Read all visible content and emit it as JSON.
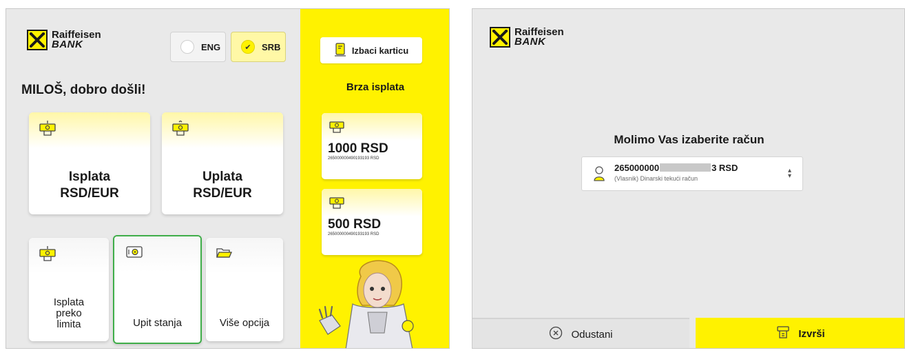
{
  "left_screen": {
    "logo": {
      "line1": "Raiffeisen",
      "line2": "BANK"
    },
    "languages": [
      {
        "label": "ENG",
        "selected": false
      },
      {
        "label": "SRB",
        "selected": true
      }
    ],
    "greeting": "MILOŠ, dobro došli!",
    "main_tiles": [
      {
        "line1": "Isplata",
        "line2": "RSD/EUR",
        "icon": "cash-withdrawal-icon"
      },
      {
        "line1": "Uplata",
        "line2": "RSD/EUR",
        "icon": "cash-deposit-icon"
      }
    ],
    "small_tiles": [
      {
        "line1": "Isplata",
        "line2": "preko",
        "line3": "limita",
        "icon": "cash-withdrawal-icon"
      },
      {
        "line1": "Upit stanja",
        "icon": "safe-icon",
        "highlighted": true
      },
      {
        "line1": "Više opcija",
        "icon": "folder-icon"
      }
    ],
    "side_panel": {
      "eject_label": "Izbaci karticu",
      "quick_title": "Brza isplata",
      "quick_cards": [
        {
          "amount": "1000 RSD",
          "account": "265000000490193193 RSD"
        },
        {
          "amount": "500 RSD",
          "account": "265000000490193193 RSD"
        }
      ]
    }
  },
  "right_screen": {
    "logo": {
      "line1": "Raiffeisen",
      "line2": "BANK"
    },
    "prompt": "Molimo Vas izaberite račun",
    "account": {
      "number_start": "265000000",
      "number_end": "3 RSD",
      "description": "(Vlasnik) Dinarski tekući račun"
    },
    "cancel_label": "Odustani",
    "confirm_label": "Izvrši"
  },
  "colors": {
    "brand_yellow": "#fff200",
    "selection_green": "#3fae49",
    "background_gray": "#e9e9e9"
  }
}
